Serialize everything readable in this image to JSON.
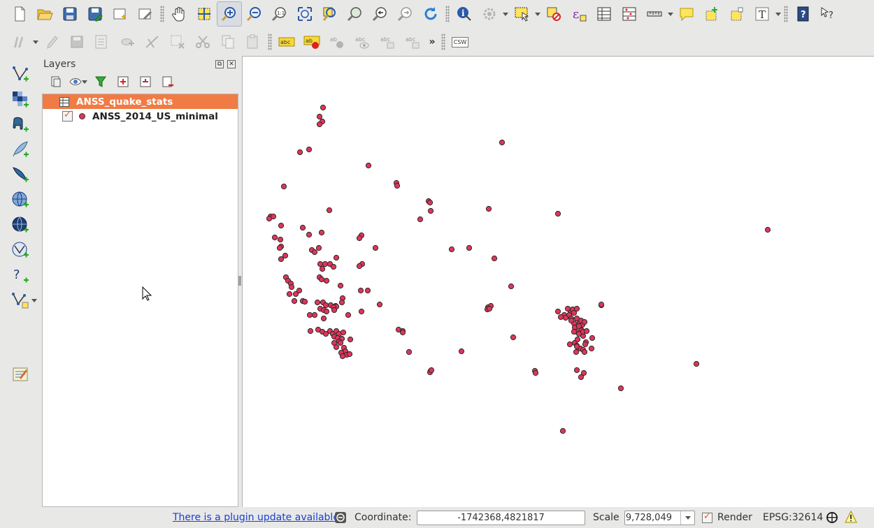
{
  "toolbar_main": {
    "buttons": [
      {
        "icon": "new-project-icon"
      },
      {
        "icon": "open-project-icon"
      },
      {
        "icon": "save-project-icon"
      },
      {
        "icon": "save-as-icon"
      },
      {
        "icon": "new-print-composer-icon"
      },
      {
        "icon": "composer-manager-icon"
      },
      {
        "icon": "pan-icon"
      },
      {
        "icon": "pan-to-selection-icon"
      },
      {
        "icon": "zoom-in-icon"
      },
      {
        "icon": "zoom-out-icon"
      },
      {
        "icon": "zoom-native-icon"
      },
      {
        "icon": "zoom-full-icon"
      },
      {
        "icon": "zoom-to-selection-icon"
      },
      {
        "icon": "zoom-to-layer-icon"
      },
      {
        "icon": "zoom-last-icon"
      },
      {
        "icon": "zoom-next-icon"
      },
      {
        "icon": "refresh-icon"
      },
      {
        "icon": "identify-icon"
      },
      {
        "icon": "run-action-icon"
      },
      {
        "icon": "select-features-icon"
      },
      {
        "icon": "deselect-icon"
      },
      {
        "icon": "field-calculator-icon"
      },
      {
        "icon": "attribute-table-icon"
      },
      {
        "icon": "statistics-icon"
      },
      {
        "icon": "measure-icon"
      },
      {
        "icon": "map-tips-icon"
      },
      {
        "icon": "new-bookmark-icon"
      },
      {
        "icon": "show-bookmarks-icon"
      },
      {
        "icon": "text-annotation-icon"
      },
      {
        "icon": "help-icon"
      },
      {
        "icon": "whats-this-icon"
      }
    ]
  },
  "toolbar_secondary": {
    "csw_label": "CSW",
    "more_label": "»"
  },
  "layers_panel": {
    "title": "Layers",
    "float_button": "⧉",
    "close_button": "✕",
    "layers": [
      {
        "name": "ANSS_quake_stats",
        "type": "table",
        "selected": true
      },
      {
        "name": "ANSS_2014_US_minimal",
        "type": "point",
        "checked": true,
        "color": "#e0355a"
      }
    ]
  },
  "map": {
    "point_color": "#e0355a",
    "point_stroke": "#2a2a2a"
  },
  "status_bar": {
    "plugin_update": "There is a plugin update available",
    "coordinate_label": "Coordinate:",
    "coordinate_value": "-1742368,4821817",
    "scale_label": "Scale",
    "scale_value": "1:9,728,049",
    "render_label": "Render",
    "render_checked": true,
    "crs": "EPSG:32614"
  }
}
